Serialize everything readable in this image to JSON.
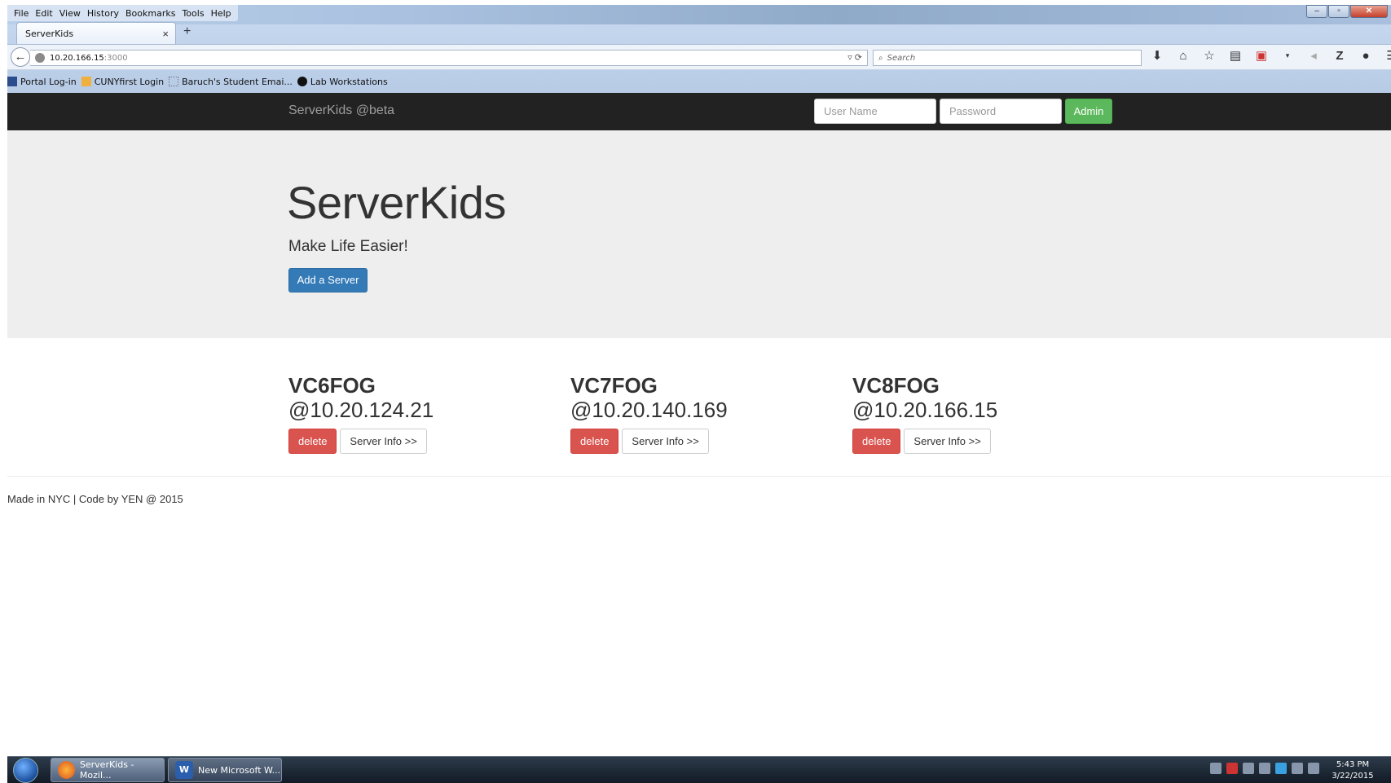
{
  "browser": {
    "menu": [
      "File",
      "Edit",
      "View",
      "History",
      "Bookmarks",
      "Tools",
      "Help"
    ],
    "tab_title": "ServerKids",
    "url_host": "10.20.166.15",
    "url_port": ":3000",
    "search_placeholder": "Search",
    "bookmarks": [
      "Portal Log-in",
      "CUNYfirst Login",
      "Baruch's Student Emai...",
      "Lab Workstations"
    ]
  },
  "app": {
    "brand": "ServerKids @beta",
    "username_placeholder": "User Name",
    "password_placeholder": "Password",
    "admin_label": "Admin"
  },
  "hero": {
    "title": "ServerKids",
    "subtitle": "Make Life Easier!",
    "add_label": "Add a Server"
  },
  "servers": [
    {
      "name": "VC6FOG",
      "ip": "@10.20.124.21",
      "delete_label": "delete",
      "info_label": "Server Info >>"
    },
    {
      "name": "VC7FOG",
      "ip": "@10.20.140.169",
      "delete_label": "delete",
      "info_label": "Server Info >>"
    },
    {
      "name": "VC8FOG",
      "ip": "@10.20.166.15",
      "delete_label": "delete",
      "info_label": "Server Info >>"
    }
  ],
  "footer": "Made in NYC | Code by YEN @ 2015",
  "taskbar": {
    "tasks": [
      "ServerKids - Mozil...",
      "New Microsoft W..."
    ],
    "time": "5:43 PM",
    "date": "3/22/2015"
  }
}
